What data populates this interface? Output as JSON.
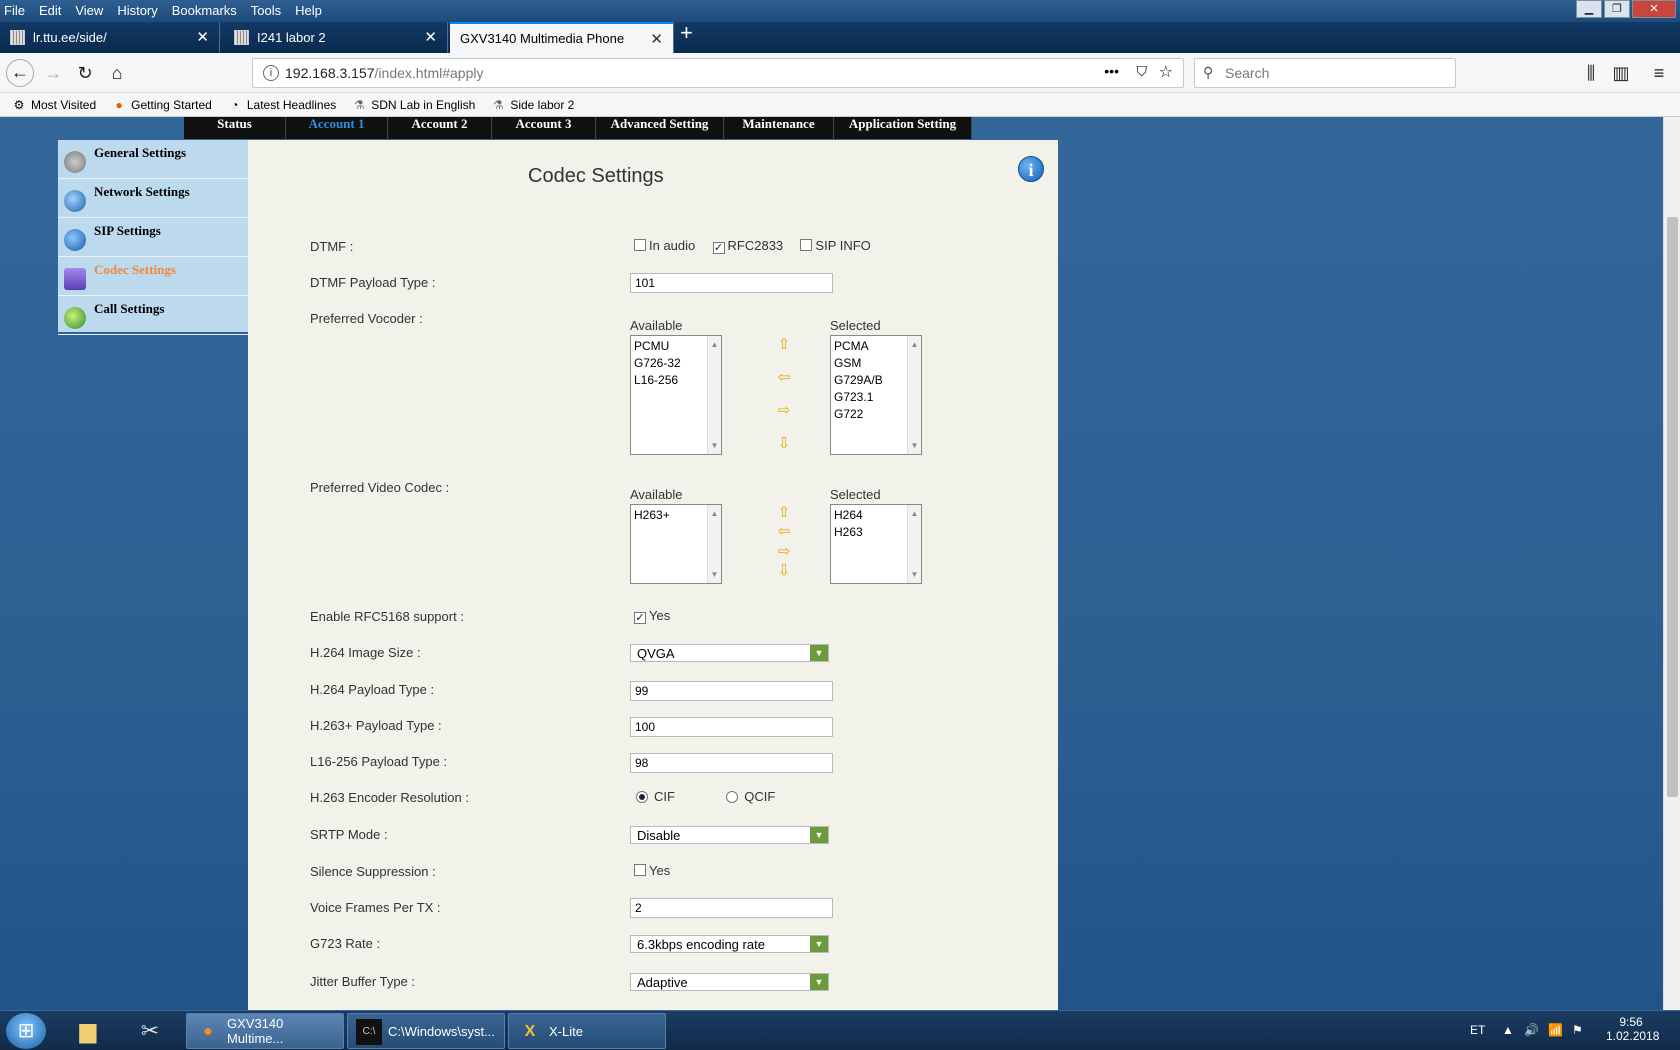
{
  "menu": [
    "File",
    "Edit",
    "View",
    "History",
    "Bookmarks",
    "Tools",
    "Help"
  ],
  "tabs": [
    {
      "label": "lr.ttu.ee/side/"
    },
    {
      "label": "I241 labor 2"
    },
    {
      "label": "GXV3140 Multimedia Phone"
    }
  ],
  "url": {
    "host": "192.168.3.157",
    "path": "/index.html#apply"
  },
  "search_placeholder": "Search",
  "bookmarks": [
    "Most Visited",
    "Getting Started",
    "Latest Headlines",
    "SDN Lab in English",
    "Side labor 2"
  ],
  "topnav": [
    "Status",
    "Account 1",
    "Account 2",
    "Account 3",
    "Advanced Setting",
    "Maintenance",
    "Application Setting"
  ],
  "sidebar": [
    "General Settings",
    "Network Settings",
    "SIP Settings",
    "Codec Settings",
    "Call Settings"
  ],
  "page_title": "Codec Settings",
  "form": {
    "dtmf_label": "DTMF :",
    "dtmf_opts": [
      "In audio",
      "RFC2833",
      "SIP INFO"
    ],
    "dtmf_payload_label": "DTMF Payload Type :",
    "dtmf_payload": "101",
    "vocoder_label": "Preferred Vocoder :",
    "available": "Available",
    "selected": "Selected",
    "vocoder_available": [
      "PCMU",
      "G726-32",
      "L16-256"
    ],
    "vocoder_selected": [
      "PCMA",
      "GSM",
      "G729A/B",
      "G723.1",
      "G722"
    ],
    "video_label": "Preferred Video Codec :",
    "video_available": [
      "H263+"
    ],
    "video_selected": [
      "H264",
      "H263"
    ],
    "rfc5168_label": "Enable RFC5168 support :",
    "yes": "Yes",
    "h264_size_label": "H.264 Image Size :",
    "h264_size": "QVGA",
    "h264_pt_label": "H.264 Payload Type :",
    "h264_pt": "99",
    "h263p_pt_label": "H.263+ Payload Type :",
    "h263p_pt": "100",
    "l16_pt_label": "L16-256 Payload Type :",
    "l16_pt": "98",
    "h263_res_label": "H.263 Encoder Resolution :",
    "res_opts": [
      "CIF",
      "QCIF"
    ],
    "srtp_label": "SRTP Mode :",
    "srtp": "Disable",
    "silence_label": "Silence Suppression :",
    "vfpt_label": "Voice Frames Per TX :",
    "vfpt": "2",
    "g723_label": "G723 Rate :",
    "g723": "6.3kbps encoding rate",
    "jitter_label": "Jitter Buffer Type :",
    "jitter": "Adaptive"
  },
  "taskbar": {
    "tasks": [
      "GXV3140 Multime...",
      "C:\\Windows\\syst...",
      "X-Lite"
    ],
    "lang": "ET",
    "time": "9:56",
    "date": "1.02.2018"
  }
}
